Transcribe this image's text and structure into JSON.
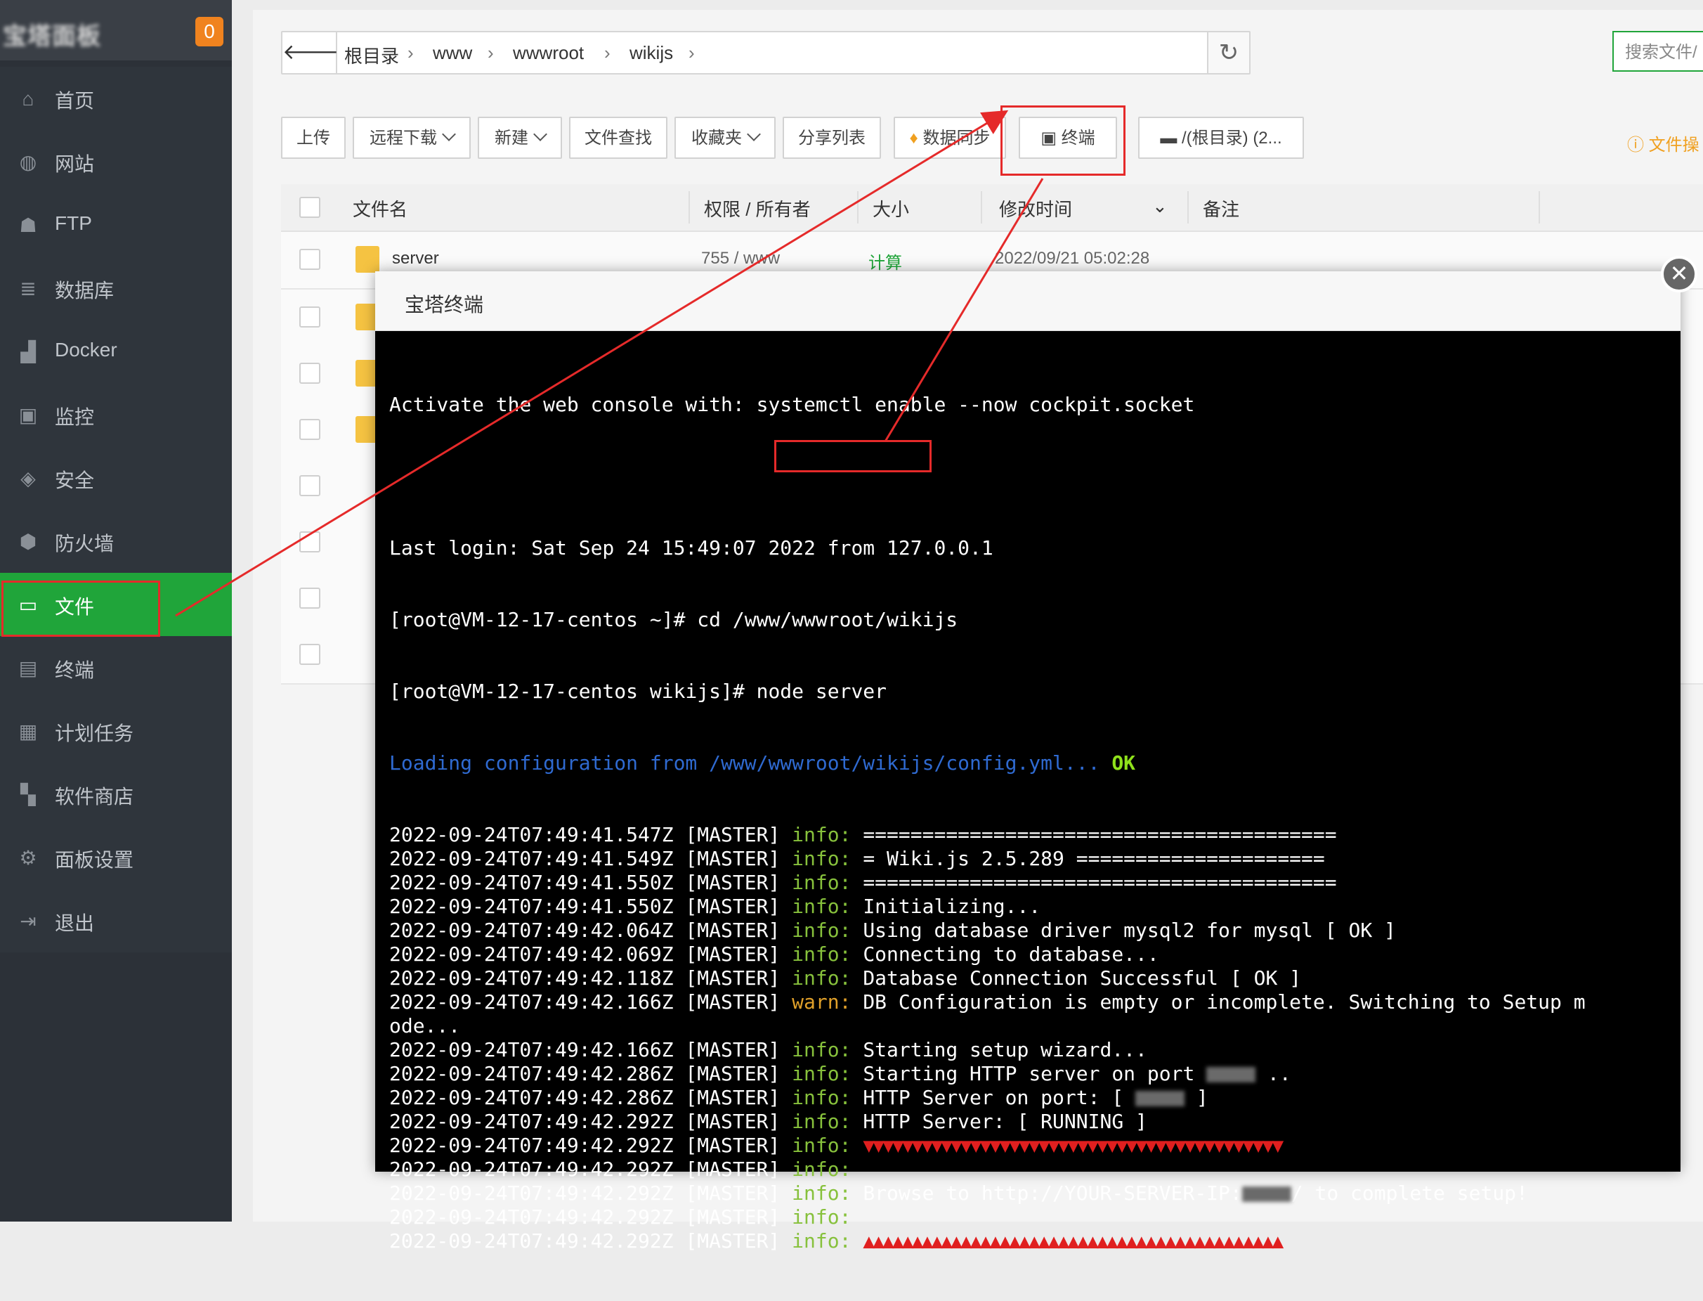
{
  "sidebar": {
    "logo_text": "宝塔面板",
    "badge": "0",
    "items": [
      {
        "label": "首页",
        "icon": "home-icon"
      },
      {
        "label": "网站",
        "icon": "globe-icon"
      },
      {
        "label": "FTP",
        "icon": "ftp-user-icon"
      },
      {
        "label": "数据库",
        "icon": "database-icon"
      },
      {
        "label": "Docker",
        "icon": "docker-icon"
      },
      {
        "label": "监控",
        "icon": "monitor-icon"
      },
      {
        "label": "安全",
        "icon": "shield-check-icon"
      },
      {
        "label": "防火墙",
        "icon": "firewall-shield-icon"
      },
      {
        "label": "文件",
        "icon": "folder-icon",
        "active": true
      },
      {
        "label": "终端",
        "icon": "terminal-icon"
      },
      {
        "label": "计划任务",
        "icon": "calendar-icon"
      },
      {
        "label": "软件商店",
        "icon": "apps-grid-icon"
      },
      {
        "label": "面板设置",
        "icon": "gear-icon"
      },
      {
        "label": "退出",
        "icon": "logout-icon"
      }
    ]
  },
  "pathbar": {
    "crumbs": [
      "根目录",
      "www",
      "wwwroot",
      "wikijs"
    ]
  },
  "search": {
    "placeholder": "搜索文件/"
  },
  "toolbar": {
    "upload": "上传",
    "remote_download": "远程下载",
    "new": "新建",
    "file_search": "文件查找",
    "favorites": "收藏夹",
    "share_list": "分享列表",
    "data_sync": "数据同步",
    "terminal": "终端",
    "disk": "/(根目录) (2...",
    "file_ops": "文件操"
  },
  "table": {
    "headers": {
      "name": "文件名",
      "perm": "权限 / 所有者",
      "size": "大小",
      "mtime": "修改时间",
      "note": "备注"
    },
    "rows": [
      {
        "name": "server",
        "perm": "755 / www",
        "size": "计算",
        "mtime": "2022/09/21 05:02:28"
      }
    ]
  },
  "dialog": {
    "title": "宝塔终端",
    "lines": [
      "Activate the web console with: systemctl enable --now cockpit.socket",
      "",
      "Last login: Sat Sep 24 15:49:07 2022 from 127.0.0.1",
      "[root@VM-12-17-centos ~]# cd /www/wwwroot/wikijs",
      "[root@VM-12-17-centos wikijs]# node server"
    ],
    "loading_text": "Loading configuration from /www/wwwroot/wikijs/config.yml... ",
    "loading_ok": "OK",
    "log_prefix_times": [
      "2022-09-24T07:49:41.547Z",
      "2022-09-24T07:49:41.549Z",
      "2022-09-24T07:49:41.550Z",
      "2022-09-24T07:49:41.550Z",
      "2022-09-24T07:49:42.064Z",
      "2022-09-24T07:49:42.069Z",
      "2022-09-24T07:49:42.118Z",
      "2022-09-24T07:49:42.166Z",
      "2022-09-24T07:49:42.166Z",
      "2022-09-24T07:49:42.286Z",
      "2022-09-24T07:49:42.286Z",
      "2022-09-24T07:49:42.292Z",
      "2022-09-24T07:49:42.292Z",
      "2022-09-24T07:49:42.292Z",
      "2022-09-24T07:49:42.292Z",
      "2022-09-24T07:49:42.292Z",
      "2022-09-24T07:49:42.292Z"
    ],
    "master": "[MASTER]",
    "level_info": "info:",
    "level_warn": "warn:",
    "messages": [
      "========================================",
      "= Wiki.js 2.5.289 =====================",
      "========================================",
      "Initializing...",
      "Using database driver mysql2 for mysql [ OK ]",
      "Connecting to database...",
      "Database Connection Successful [ OK ]",
      "DB Configuration is empty or incomplete. Switching to Setup m",
      "Starting setup wizard...",
      "Starting HTTP server on port ",
      "HTTP Server on port: [ ",
      "HTTP Server: [ RUNNING ]",
      "",
      "",
      "Browse to http://YOUR-SERVER-IP:",
      "",
      ""
    ],
    "warn_continuation": "ode...",
    "port_suffix": " ..",
    "port_close": " ]",
    "browse_suffix": "/ to complete setup!",
    "arrows_down": "▼▼▼▼▼▼▼▼▼▼▼▼▼▼▼▼▼▼▼▼▼▼▼▼▼▼▼▼▼▼▼▼▼▼▼▼▼▼▼▼▼▼▼",
    "arrows_up": "▲▲▲▲▲▲▲▲▲▲▲▲▲▲▲▲▲▲▲▲▲▲▲▲▲▲▲▲▲▲▲▲▲▲▲▲▲▲▲▲▲▲▲"
  },
  "colors": {
    "sidebar_bg": "#2c3138",
    "active": "#20a53a",
    "annotation_red": "#e52a2a",
    "info_green": "#87c13c",
    "warn_orange": "#e0a02a"
  }
}
